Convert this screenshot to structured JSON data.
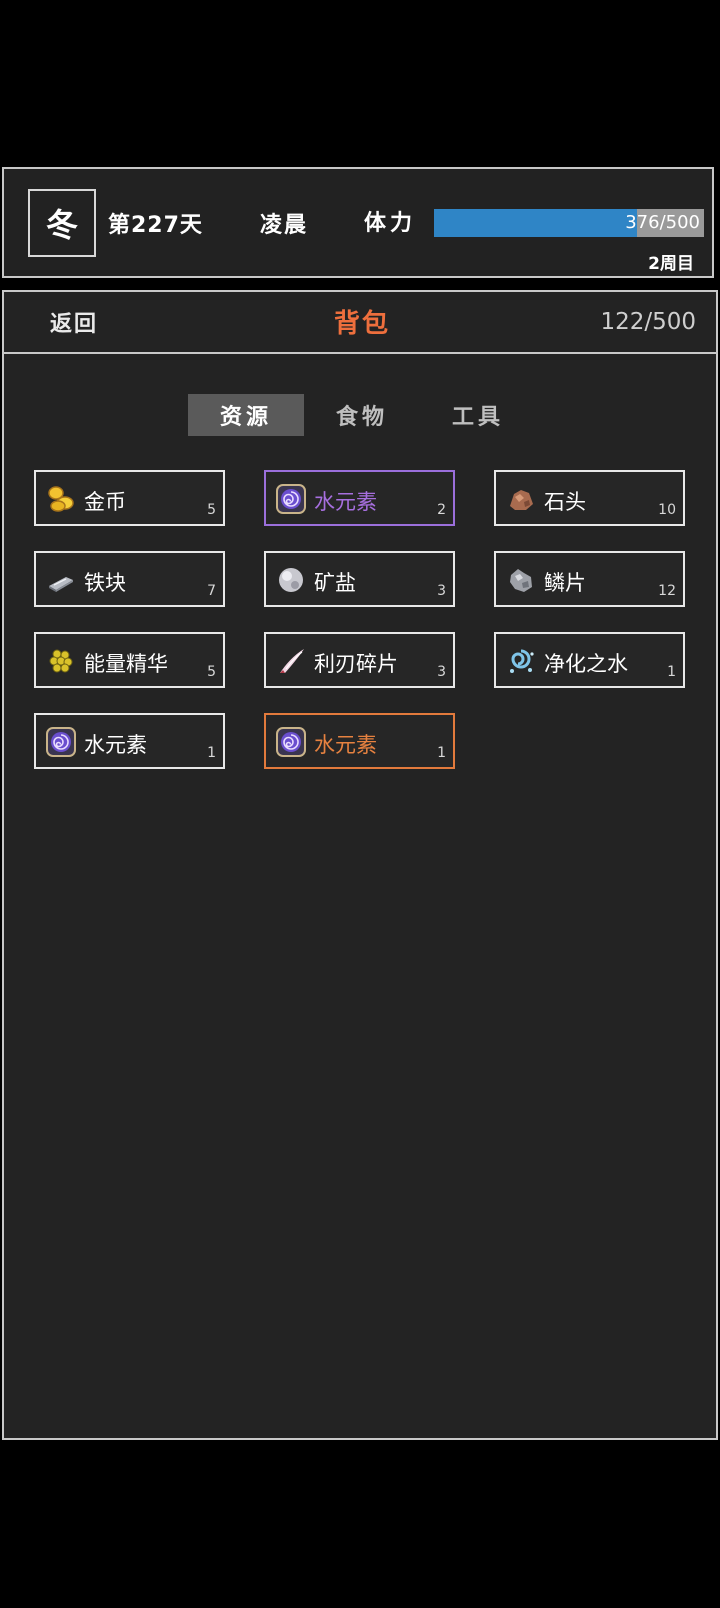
{
  "status": {
    "season": "冬",
    "day": "第227天",
    "time_of_day": "凌晨",
    "stamina_label": "体力",
    "stamina_text": "376/500",
    "stamina_fraction": 0.752,
    "cycle": "2周目"
  },
  "header": {
    "back_label": "返回",
    "title": "背包",
    "capacity": "122/500"
  },
  "tabs": [
    {
      "label": "资源",
      "active": true
    },
    {
      "label": "食物",
      "active": false
    },
    {
      "label": "工具",
      "active": false
    }
  ],
  "items": [
    {
      "name": "金币",
      "count": "5",
      "icon": "gold-coins-icon",
      "style": "normal"
    },
    {
      "name": "水元素",
      "count": "2",
      "icon": "water-element-icon",
      "style": "purple"
    },
    {
      "name": "石头",
      "count": "10",
      "icon": "stone-icon",
      "style": "normal"
    },
    {
      "name": "铁块",
      "count": "7",
      "icon": "iron-ingot-icon",
      "style": "normal"
    },
    {
      "name": "矿盐",
      "count": "3",
      "icon": "rock-salt-icon",
      "style": "normal"
    },
    {
      "name": "鳞片",
      "count": "12",
      "icon": "scale-icon",
      "style": "normal"
    },
    {
      "name": "能量精华",
      "count": "5",
      "icon": "energy-essence-icon",
      "style": "normal"
    },
    {
      "name": "利刃碎片",
      "count": "3",
      "icon": "blade-shard-icon",
      "style": "normal"
    },
    {
      "name": "净化之水",
      "count": "1",
      "icon": "purified-water-icon",
      "style": "normal"
    },
    {
      "name": "水元素",
      "count": "1",
      "icon": "water-element-icon",
      "style": "normal"
    },
    {
      "name": "水元素",
      "count": "1",
      "icon": "water-element-icon",
      "style": "orange"
    }
  ],
  "colors": {
    "accent_title": "#ee6f3d",
    "stamina_fill": "#2f85c6",
    "rare_purple": "#a76fdf",
    "rare_orange": "#e78240"
  }
}
